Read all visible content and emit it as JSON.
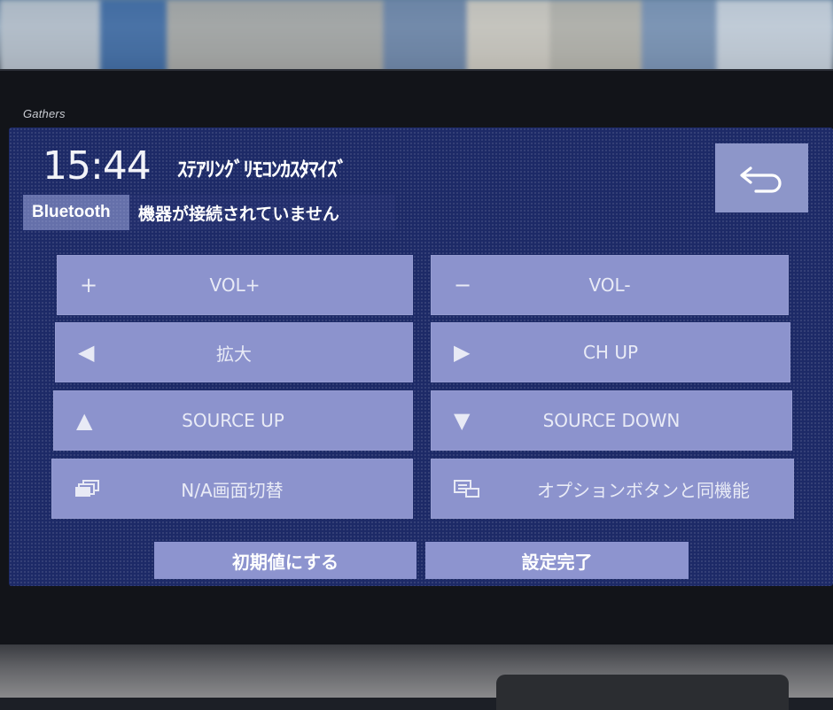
{
  "device": {
    "brand": "Gathers"
  },
  "header": {
    "clock": "15:44",
    "title": "ｽﾃｱﾘﾝｸﾞﾘﾓｺﾝｶｽﾀﾏｲｽﾞ",
    "back_icon": "return-arrow-icon"
  },
  "status": {
    "tag": "Bluetooth",
    "message": "機器が接続されていません"
  },
  "buttons": {
    "vol_plus": {
      "icon_glyph": "+",
      "label": "VOL+"
    },
    "vol_minus": {
      "icon_glyph": "−",
      "label": "VOL-"
    },
    "zoom": {
      "icon_glyph": "◀",
      "label": "拡大"
    },
    "ch_up": {
      "icon_glyph": "▶",
      "label": "CH UP"
    },
    "source_up": {
      "icon_glyph": "▲",
      "label": "SOURCE UP"
    },
    "source_down": {
      "icon_glyph": "▼",
      "label": "SOURCE DOWN"
    },
    "na_screen": {
      "icon": "screens-stack-icon",
      "label": "N/A画面切替"
    },
    "option": {
      "icon": "option-screen-icon",
      "label": "オプションボタンと同機能"
    }
  },
  "footer": {
    "reset_label": "初期値にする",
    "done_label": "設定完了"
  },
  "colors": {
    "screen_bg": "#1d2a67",
    "button_bg": "#8c93cd",
    "text": "#ffffff"
  }
}
